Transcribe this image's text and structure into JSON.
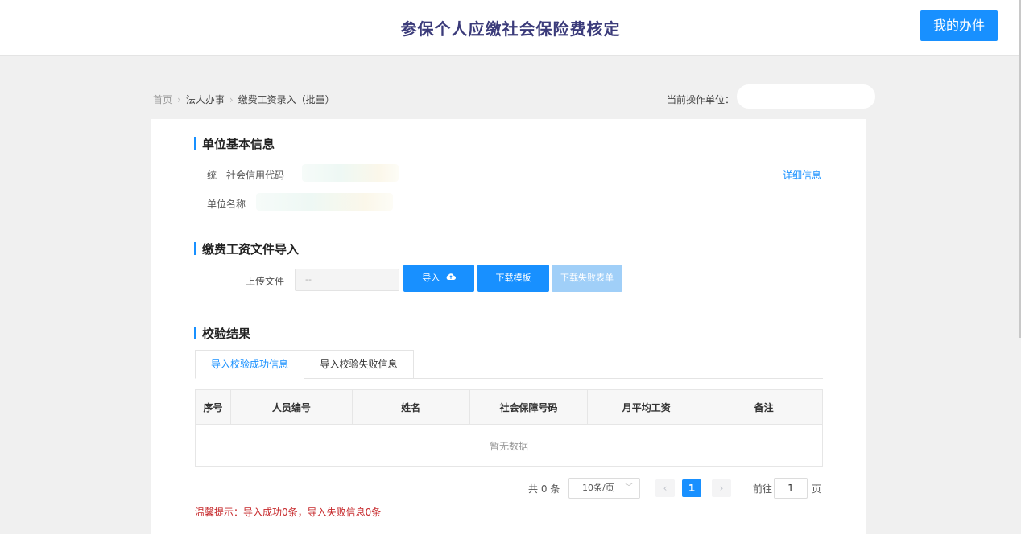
{
  "header": {
    "title": "参保个人应缴社会保险费核定",
    "my_tasks_label": "我的办件"
  },
  "breadcrumb": {
    "home": "首页",
    "legal": "法人办事",
    "current": "缴费工资录入（批量）"
  },
  "operator": {
    "label": "当前操作单位："
  },
  "basic_info": {
    "title": "单位基本信息",
    "credit_code_label": "统一社会信用代码",
    "unit_name_label": "单位名称",
    "detail_link": "详细信息"
  },
  "upload": {
    "title": "缴费工资文件导入",
    "file_label": "上传文件",
    "file_placeholder": "--",
    "import_label": "导入",
    "download_template_label": "下载模板",
    "download_fail_label": "下载失败表单"
  },
  "validation": {
    "title": "校验结果",
    "tabs": [
      {
        "label": "导入校验成功信息",
        "active": true
      },
      {
        "label": "导入校验失败信息",
        "active": false
      }
    ],
    "columns": [
      "序号",
      "人员编号",
      "姓名",
      "社会保障号码",
      "月平均工资",
      "备注"
    ],
    "empty_text": "暂无数据"
  },
  "pagination": {
    "total_text": "共 0 条",
    "page_size": "10条/页",
    "current_page": "1",
    "goto_label": "前往",
    "goto_value": "1",
    "page_unit": "页"
  },
  "warning": "温馨提示：导入成功0条，导入失败信息0条",
  "colors": {
    "accent": "#1890ff",
    "disabled_button": "#a0cff8",
    "warning_text": "#c6282b",
    "title_text": "#3b3b7a"
  }
}
